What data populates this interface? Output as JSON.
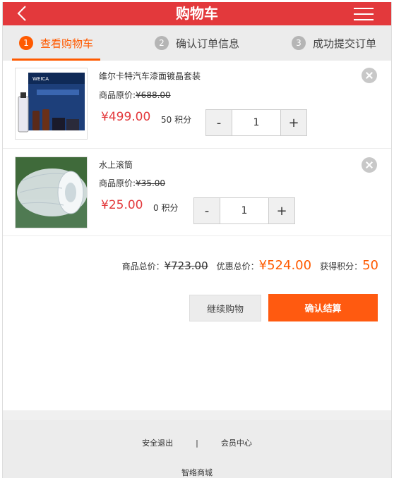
{
  "header": {
    "title": "购物车"
  },
  "steps": [
    {
      "num": "1",
      "label": "查看购物车"
    },
    {
      "num": "2",
      "label": "确认订单信息"
    },
    {
      "num": "3",
      "label": "成功提交订单"
    }
  ],
  "items": [
    {
      "name": "维尔卡特汽车漆面镀晶套装",
      "orig_label": "商品原价:",
      "orig_price": "¥688.00",
      "price": "¥499.00",
      "points": "50 积分",
      "qty": "1",
      "thumb_text": "WEICA"
    },
    {
      "name": "水上滚筒",
      "orig_label": "商品原价:",
      "orig_price": "¥35.00",
      "price": "¥25.00",
      "points": "0 积分",
      "qty": "1"
    }
  ],
  "stepper": {
    "minus": "-",
    "plus": "+"
  },
  "summary": {
    "total_label": "商品总价：",
    "total_value": "¥723.00",
    "discount_label": "优惠总价：",
    "discount_value": "¥524.00",
    "points_label": "获得积分：",
    "points_value": "50"
  },
  "buttons": {
    "continue": "继续购物",
    "checkout": "确认结算"
  },
  "footer": {
    "logout": "安全退出",
    "separator": "|",
    "member": "会员中心",
    "brand": "智络商城"
  },
  "colors": {
    "header": "#e3393c",
    "accent": "#ff5a00",
    "price": "#e3393c"
  },
  "icons": {
    "back": "chevron-left-icon",
    "menu": "hamburger-menu-icon",
    "remove": "close-circle-icon"
  }
}
